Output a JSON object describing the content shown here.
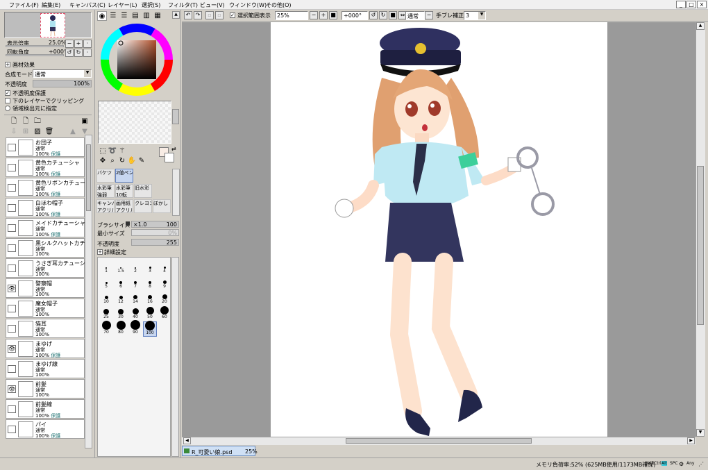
{
  "menu": [
    "ファイル(F)",
    "編集(E)",
    "キャンバス(C)",
    "レイヤー(L)",
    "選択(S)",
    "フィルタ(T)",
    "ビュー(V)",
    "ウィンドウ(W)",
    "その他(O)"
  ],
  "window_buttons": {
    "minimize": "_",
    "restore": "□",
    "close": "×"
  },
  "navigator": {
    "zoom_label": "表示倍率",
    "zoom_value": "25.0%",
    "rotate_label": "回転角度",
    "rotate_value": "+000°"
  },
  "layer_settings": {
    "section": "画材効果",
    "blend_label": "合成モード",
    "blend_value": "通常",
    "opacity_label": "不透明度",
    "opacity_value": "100%",
    "preserve_opacity": "不透明度保護",
    "clip_lower": "下のレイヤーでクリッピング",
    "selection_source": "領域検出元に指定"
  },
  "layers": [
    {
      "name": "お団子",
      "mode": "通常",
      "opacity": "100%",
      "protect": "保護",
      "visible": false
    },
    {
      "name": "黄色カチューシャ",
      "mode": "通常",
      "opacity": "100%",
      "protect": "保護",
      "visible": false
    },
    {
      "name": "黄色リボンカチューシ…",
      "mode": "通常",
      "opacity": "100%",
      "protect": "保護",
      "visible": false
    },
    {
      "name": "白ほわ帽子",
      "mode": "通常",
      "opacity": "100%",
      "protect": "保護",
      "visible": false
    },
    {
      "name": "メイドカチューシャ",
      "mode": "通常",
      "opacity": "100%",
      "protect": "保護",
      "visible": false
    },
    {
      "name": "黒シルクハットカチュ…",
      "mode": "通常",
      "opacity": "100%",
      "protect": "",
      "visible": false
    },
    {
      "name": "うさぎ耳カチューシャ",
      "mode": "通常",
      "opacity": "100%",
      "protect": "",
      "visible": false
    },
    {
      "name": "警察帽",
      "mode": "通常",
      "opacity": "100%",
      "protect": "",
      "visible": true
    },
    {
      "name": "魔女帽子",
      "mode": "通常",
      "opacity": "100%",
      "protect": "",
      "visible": false
    },
    {
      "name": "猫耳",
      "mode": "通常",
      "opacity": "100%",
      "protect": "",
      "visible": false
    },
    {
      "name": "まゆげ",
      "mode": "通常",
      "opacity": "100%",
      "protect": "保護",
      "visible": true
    },
    {
      "name": "まゆげ線",
      "mode": "通常",
      "opacity": "100%",
      "protect": "",
      "visible": false
    },
    {
      "name": "前髪",
      "mode": "通常",
      "opacity": "100%",
      "protect": "",
      "visible": true
    },
    {
      "name": "前髪線",
      "mode": "通常",
      "opacity": "100%",
      "protect": "保護",
      "visible": false
    },
    {
      "name": "パイ",
      "mode": "通常",
      "opacity": "100%",
      "protect": "保護",
      "visible": false
    }
  ],
  "tools": [
    {
      "name": "バケツ",
      "sub": ""
    },
    {
      "name": "2値ペン",
      "sub": ""
    },
    {
      "name": "水彩筆",
      "sub": "強弱"
    },
    {
      "name": "水彩筆",
      "sub": "10転"
    },
    {
      "name": "旧水彩",
      "sub": ""
    },
    {
      "name": "キャンバス",
      "sub": "アクリル"
    },
    {
      "name": "画用紙",
      "sub": "アクリル"
    },
    {
      "name": "クレヨン",
      "sub": ""
    },
    {
      "name": "ぼかし",
      "sub": ""
    }
  ],
  "brush_settings": {
    "size_label": "ブラシサイズ",
    "size_mult": "×1.0",
    "size_value": "100",
    "min_label": "最小サイズ",
    "min_value": "0%",
    "density_label": "不透明度",
    "density_value": "255",
    "detail_label": "詳細設定"
  },
  "brush_sizes": [
    "1",
    "1.5",
    "2",
    "3",
    "4",
    "5",
    "6",
    "7",
    "8",
    "9",
    "10",
    "12",
    "14",
    "16",
    "20",
    "25",
    "30",
    "40",
    "50",
    "60",
    "70",
    "80",
    "90",
    "100"
  ],
  "selected_brush": "100",
  "toolbar": {
    "show_selection": "選択範囲表示",
    "zoom": "25%",
    "rotation": "+000°",
    "blend": "通常",
    "stabilizer_label": "手ブレ補正",
    "stabilizer_value": "3"
  },
  "file_tab": {
    "name": "R_可愛い娘.psd",
    "zoom": "25%"
  },
  "status": {
    "memory": "メモリ負荷率:52% (625MB使用/1173MB確保)",
    "keys": [
      "Shift",
      "Ctrl",
      "Alt",
      "SPC",
      "Any"
    ]
  },
  "colors": {
    "accent": "#6c8ebf",
    "selected_tool": "#c7d6f0",
    "paper": "#ffffff",
    "workspace": "#9a9a9a"
  }
}
